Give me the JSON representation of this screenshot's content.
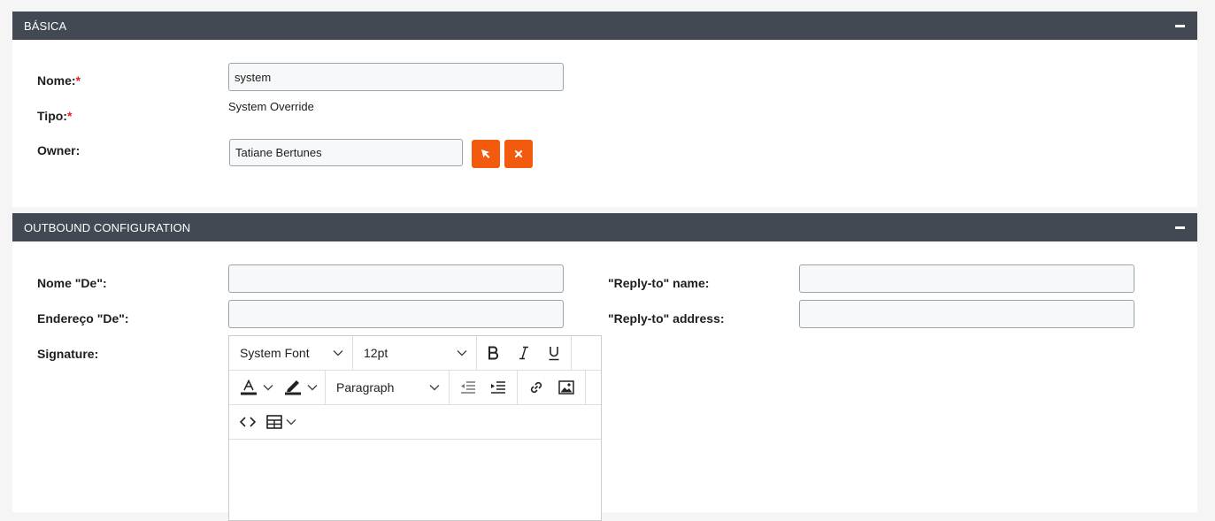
{
  "basica": {
    "title": "BÁSICA",
    "nome_label": "Nome:",
    "nome_value": "system",
    "tipo_label": "Tipo:",
    "tipo_value": "System Override",
    "owner_label": "Owner:",
    "owner_value": "Tatiane Bertunes",
    "required_mark": "*"
  },
  "outbound": {
    "title": "OUTBOUND CONFIGURATION",
    "from_name_label": "Nome \"De\":",
    "from_name_value": "",
    "from_address_label": "Endereço \"De\":",
    "from_address_value": "",
    "reply_name_label": "\"Reply-to\" name:",
    "reply_name_value": "",
    "reply_address_label": "\"Reply-to\" address:",
    "reply_address_value": "",
    "signature_label": "Signature:"
  },
  "editor": {
    "font_family": "System Font",
    "font_size": "12pt",
    "block_format": "Paragraph"
  },
  "colors": {
    "header_bg": "#424952",
    "accent": "#f25a0d",
    "required": "#e02020"
  }
}
